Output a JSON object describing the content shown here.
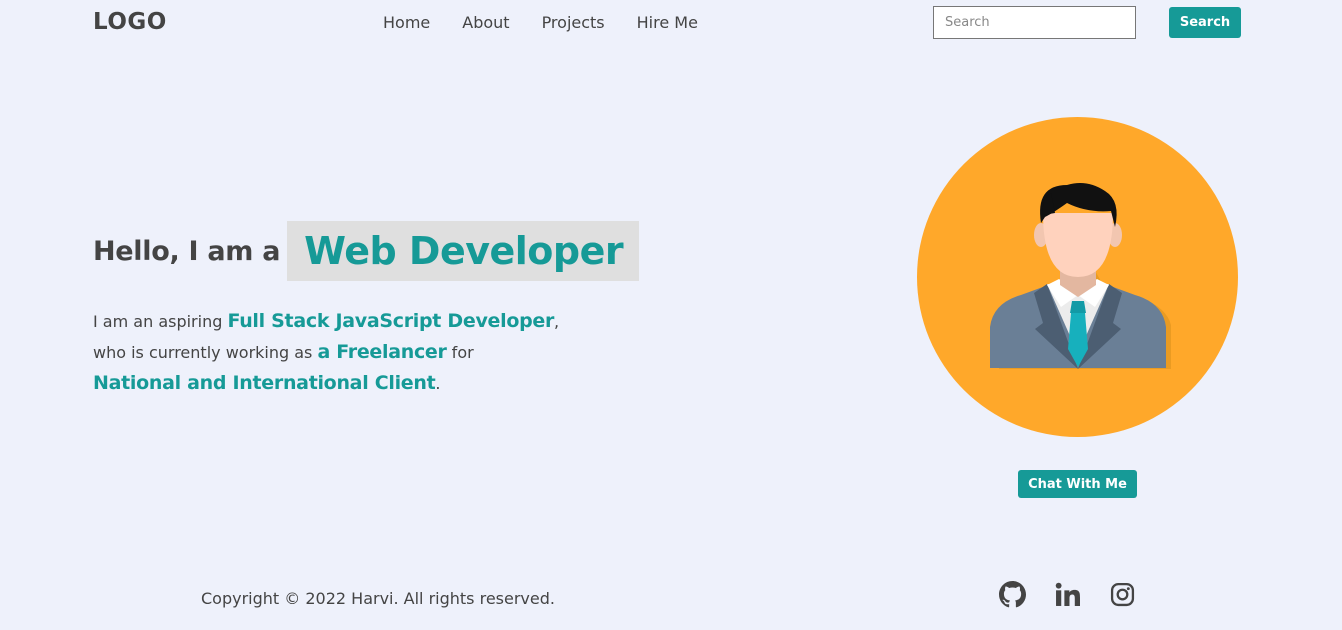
{
  "header": {
    "logo": "LOGO",
    "nav": [
      {
        "label": "Home"
      },
      {
        "label": "About"
      },
      {
        "label": "Projects"
      },
      {
        "label": "Hire Me"
      }
    ],
    "search_placeholder": "Search",
    "search_button": "Search"
  },
  "hero": {
    "greeting": "Hello, I am a",
    "role": "Web Developer",
    "intro": {
      "p1": "I am an aspiring ",
      "h1": "Full Stack JavaScript Developer",
      "p2": ",",
      "p3": "who is currently working as ",
      "h2": "a Freelancer",
      "p4": " for",
      "h3": "National and International Client",
      "p5": "."
    },
    "chat_button": "Chat With Me"
  },
  "footer": {
    "copyright": "Copyright © 2022 Harvi. All rights reserved.",
    "social_icons": [
      "github-icon",
      "linkedin-icon",
      "instagram-icon"
    ]
  },
  "colors": {
    "accent": "#169a97",
    "background": "#eef1fb",
    "avatar_bg": "#ffa82a",
    "text": "#444444"
  }
}
